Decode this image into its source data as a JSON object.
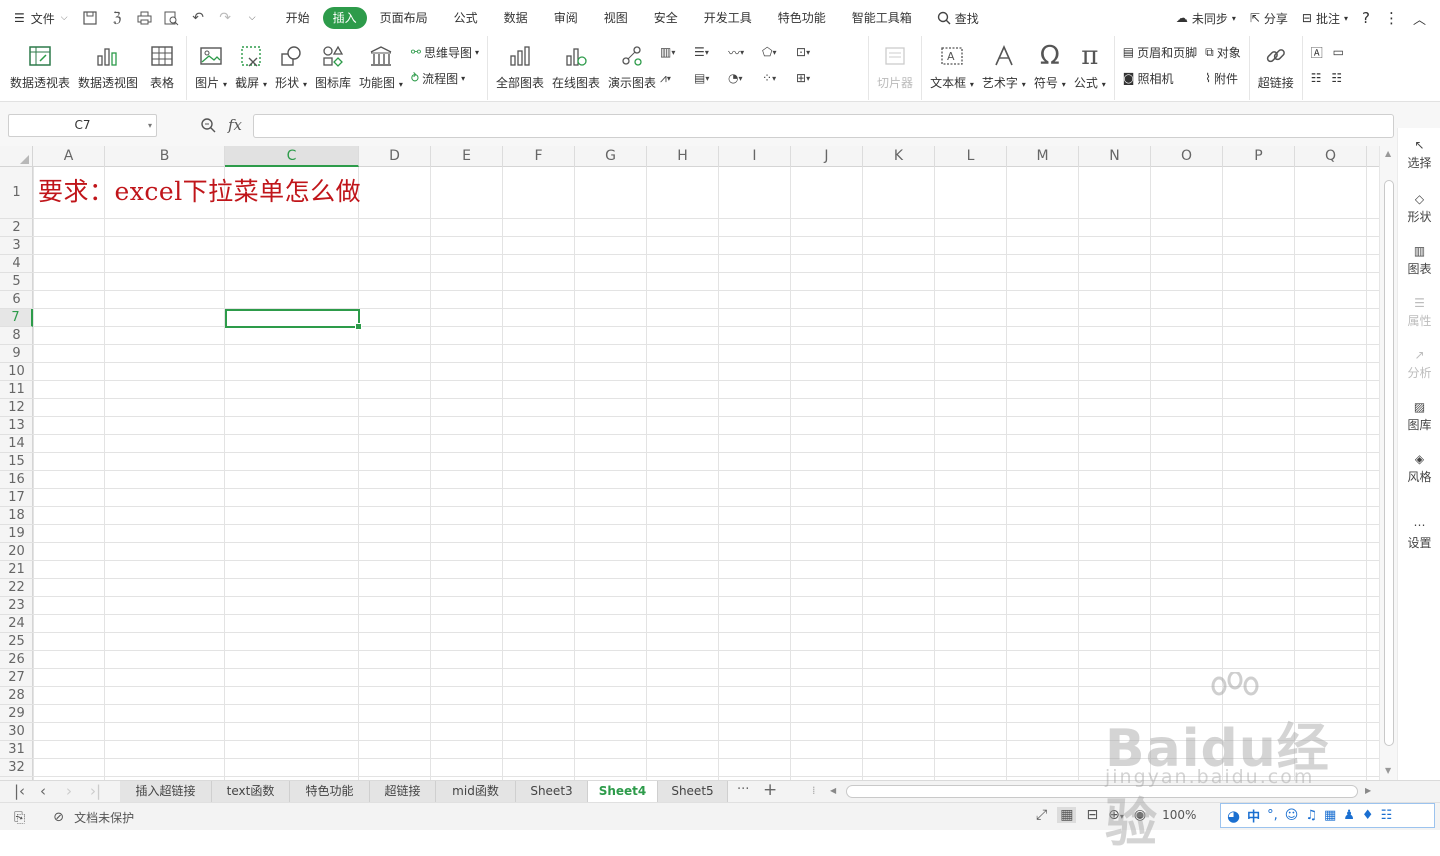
{
  "menubar": {
    "file_label": "文件",
    "tabs": [
      "开始",
      "插入",
      "页面布局",
      "公式",
      "数据",
      "审阅",
      "视图",
      "安全",
      "开发工具",
      "特色功能",
      "智能工具箱"
    ],
    "active_tab": "插入",
    "search_label": "查找",
    "sync_label": "未同步",
    "share_label": "分享",
    "comment_label": "批注"
  },
  "ribbon": {
    "pivot_table": "数据透视表",
    "pivot_chart": "数据透视图",
    "table": "表格",
    "picture": "图片",
    "screenshot": "截屏",
    "shape": "形状",
    "icon_lib": "图标库",
    "func_chart": "功能图",
    "mind_map": "思维导图",
    "flow_chart": "流程图",
    "all_charts": "全部图表",
    "online_chart": "在线图表",
    "demo_chart": "演示图表",
    "slicer": "切片器",
    "textbox": "文本框",
    "wordart": "艺术字",
    "symbol": "符号",
    "formula": "公式",
    "header_footer": "页眉和页脚",
    "camera": "照相机",
    "object": "对象",
    "attachment": "附件",
    "hyperlink": "超链接"
  },
  "formula_bar": {
    "name_box": "C7",
    "fx": "fx",
    "value": ""
  },
  "grid": {
    "columns": [
      "A",
      "B",
      "C",
      "D",
      "E",
      "F",
      "G",
      "H",
      "I",
      "J",
      "K",
      "L",
      "M",
      "N",
      "O",
      "P",
      "Q"
    ],
    "selected_column": "C",
    "rows": [
      "1",
      "2",
      "3",
      "4",
      "5",
      "6",
      "7",
      "8",
      "9",
      "10",
      "11",
      "12",
      "13",
      "14",
      "15",
      "16",
      "17",
      "18",
      "19",
      "20",
      "21",
      "22",
      "23",
      "24",
      "25",
      "26",
      "27",
      "28",
      "29",
      "30",
      "31",
      "32"
    ],
    "selected_row": "7",
    "cell_a1": "要求：excel下拉菜单怎么做"
  },
  "sidebar": {
    "items": [
      {
        "label": "选择",
        "icon": "cursor-icon",
        "enabled": true
      },
      {
        "label": "形状",
        "icon": "shape-icon",
        "enabled": true
      },
      {
        "label": "图表",
        "icon": "chart-icon",
        "enabled": true
      },
      {
        "label": "属性",
        "icon": "properties-icon",
        "enabled": false
      },
      {
        "label": "分析",
        "icon": "analysis-icon",
        "enabled": false
      },
      {
        "label": "图库",
        "icon": "gallery-icon",
        "enabled": true
      },
      {
        "label": "风格",
        "icon": "style-icon",
        "enabled": true
      },
      {
        "label": "设置",
        "icon": "more-icon",
        "enabled": true
      }
    ]
  },
  "sheets": {
    "tabs": [
      "插入超链接",
      "text函数",
      "特色功能",
      "超链接",
      "mid函数",
      "Sheet3",
      "Sheet4",
      "Sheet5"
    ],
    "active": "Sheet4",
    "more": "···",
    "add": "+"
  },
  "status": {
    "protect_label": "文档未保护",
    "zoom": "100%"
  },
  "ime": {
    "lang": "中"
  },
  "watermark": {
    "line1": "Baidu经验",
    "line2": "jingyan.baidu.com"
  },
  "colors": {
    "accent": "#2d9b4a",
    "title_text": "#c0151a"
  }
}
